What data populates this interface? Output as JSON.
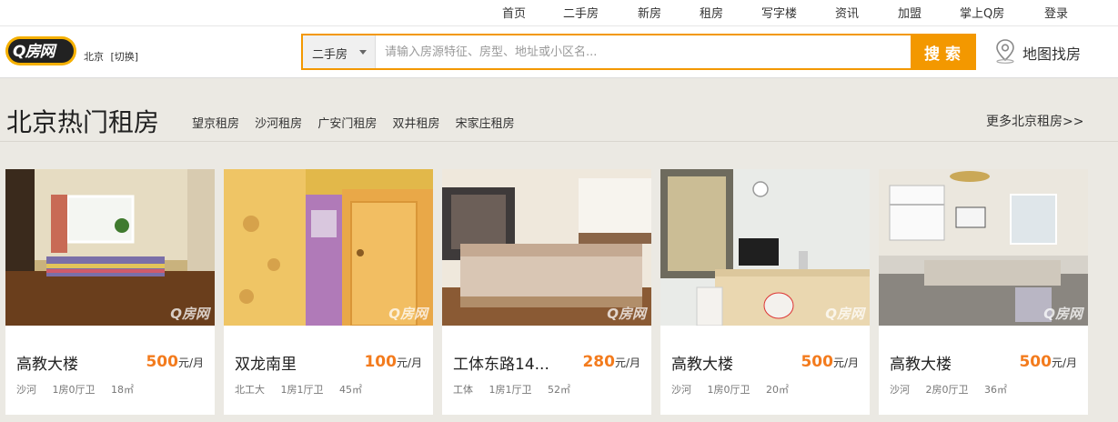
{
  "top_nav": [
    "首页",
    "二手房",
    "新房",
    "租房",
    "写字楼",
    "资讯",
    "加盟",
    "掌上Q房",
    "登录"
  ],
  "logo": {
    "text": "Q房网"
  },
  "city": {
    "name": "北京",
    "switch": "[切换]"
  },
  "search": {
    "type": "二手房",
    "placeholder": "请输入房源特征、房型、地址或小区名...",
    "button": "搜索"
  },
  "map_link": {
    "label": "地图找房"
  },
  "section": {
    "title": "北京热门租房",
    "hot_links": [
      "望京租房",
      "沙河租房",
      "广安门租房",
      "双井租房",
      "宋家庄租房"
    ],
    "more": "更多北京租房>>"
  },
  "watermark": "Q房网",
  "colors": {
    "accent": "#f39800",
    "price": "#f37b1d",
    "background": "#ebe9e3"
  },
  "listings": [
    {
      "title": "高教大楼",
      "price": "500",
      "unit": "元/月",
      "area": "沙河",
      "layout": "1房0厅卫",
      "size": "18㎡"
    },
    {
      "title": "双龙南里",
      "price": "100",
      "unit": "元/月",
      "area": "北工大",
      "layout": "1房1厅卫",
      "size": "45㎡"
    },
    {
      "title": "工体东路14...",
      "price": "280",
      "unit": "元/月",
      "area": "工体",
      "layout": "1房1厅卫",
      "size": "52㎡"
    },
    {
      "title": "高教大楼",
      "price": "500",
      "unit": "元/月",
      "area": "沙河",
      "layout": "1房0厅卫",
      "size": "20㎡"
    },
    {
      "title": "高教大楼",
      "price": "500",
      "unit": "元/月",
      "area": "沙河",
      "layout": "2房0厅卫",
      "size": "36㎡"
    }
  ]
}
